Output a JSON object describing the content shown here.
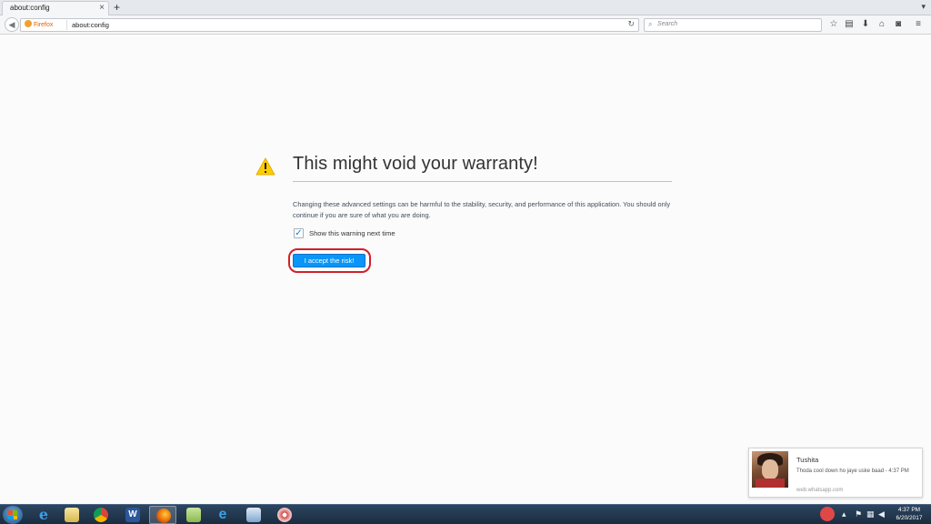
{
  "browser": {
    "tab_title": "about:config",
    "tab_close": "×",
    "new_tab": "+",
    "identity_label": "Firefox",
    "url": "about:config",
    "search_placeholder": "Search"
  },
  "page": {
    "title": "This might void your warranty!",
    "description": "Changing these advanced settings can be harmful to the stability, security, and performance of this application. You should only continue if you are sure of what you are doing.",
    "checkbox_label": "Show this warning next time",
    "checkbox_checked": true,
    "accept_button": "I accept the risk!"
  },
  "notification": {
    "sender": "Tushita",
    "message": "Thoda cool down ho jaye uske baad - 4:37 PM",
    "source": "web.whatsapp.com"
  },
  "taskbar": {
    "apps": [
      "internet-explorer",
      "file-explorer",
      "chrome",
      "word",
      "firefox",
      "folder",
      "edge",
      "screenshot",
      "paint"
    ],
    "clock_time": "4:37 PM",
    "clock_date": "6/20/2017"
  },
  "colors": {
    "accent_button": "#0996f8",
    "warning_icon": "#ffcc00",
    "annotation_ring": "#d0202a"
  }
}
